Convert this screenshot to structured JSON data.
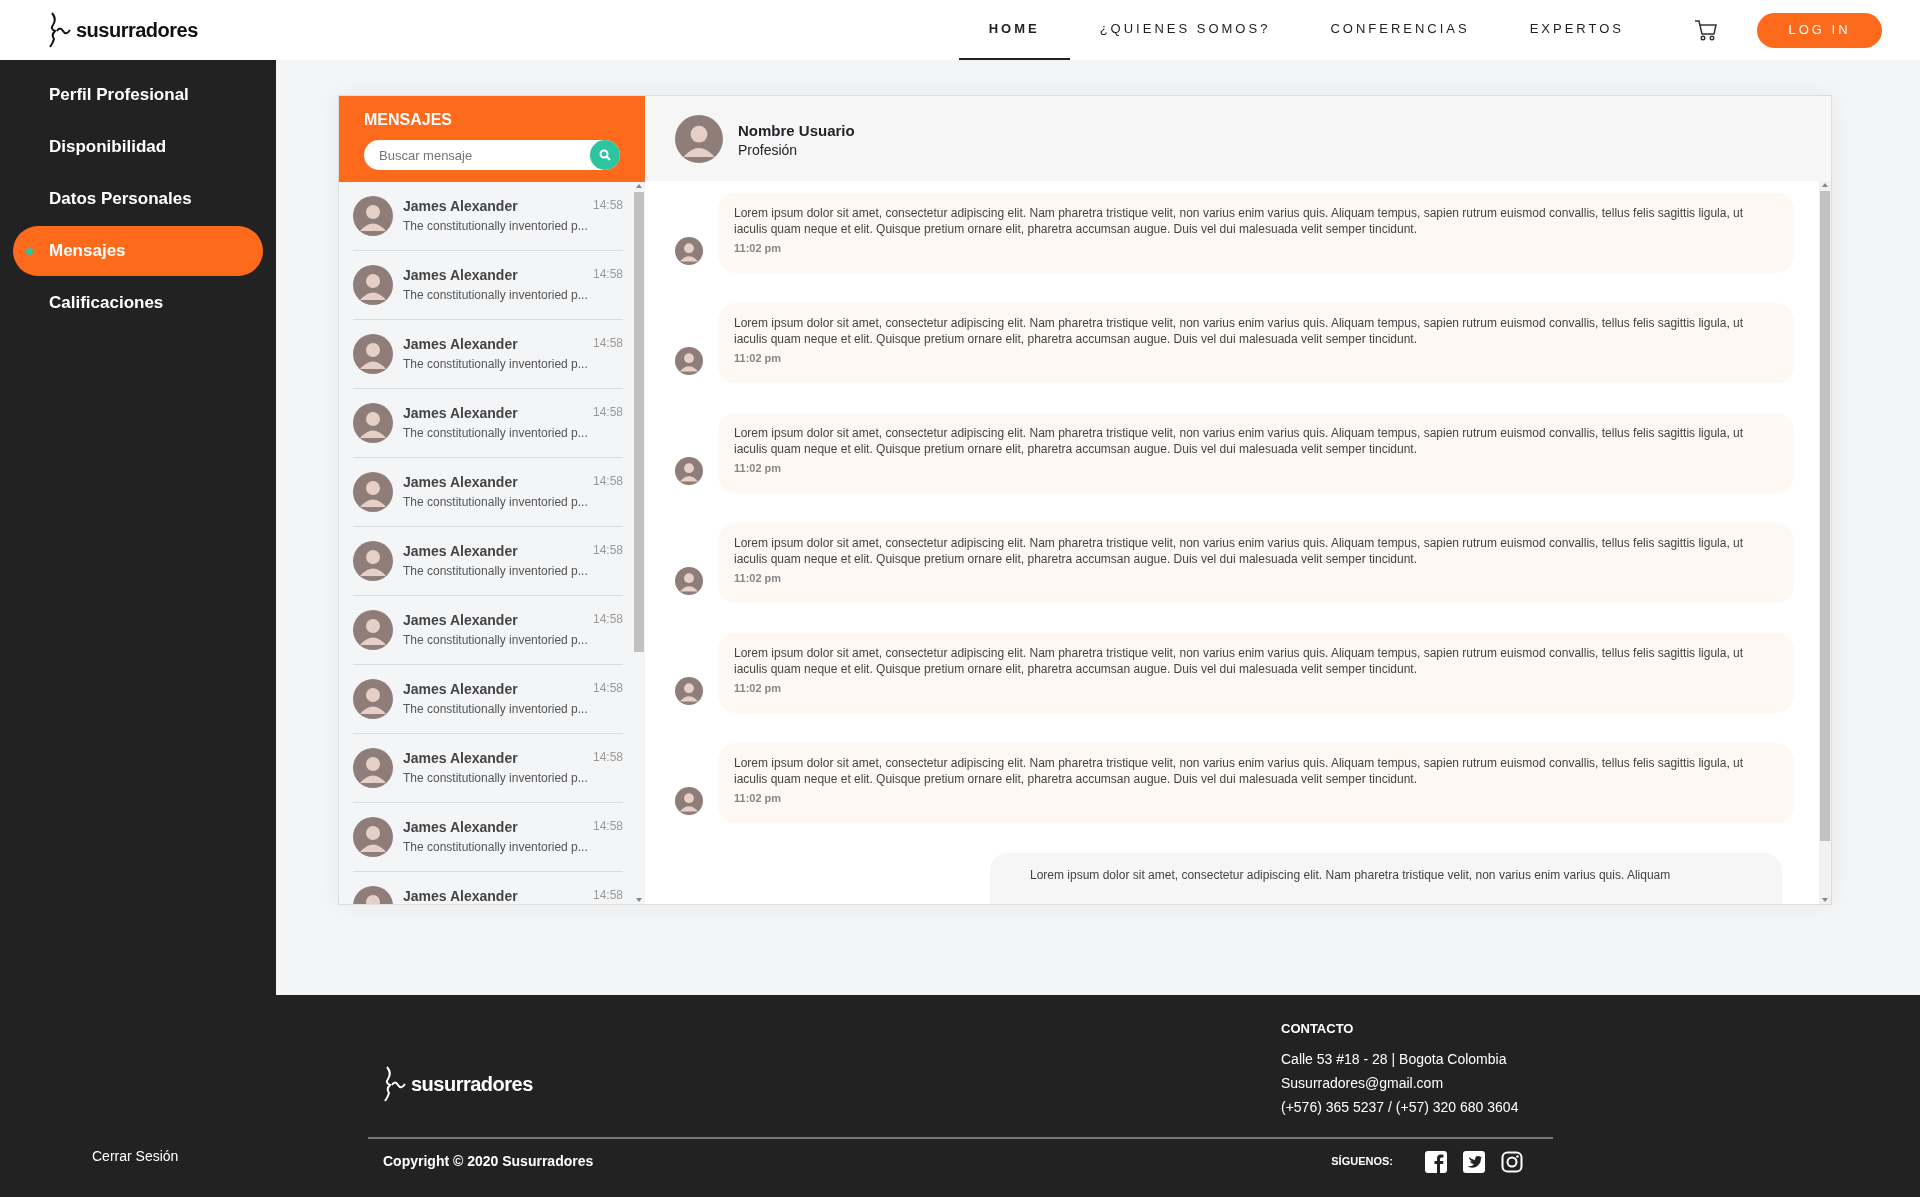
{
  "header": {
    "logo": "susurradores",
    "nav": [
      {
        "label": "HOME",
        "selected": true
      },
      {
        "label": "¿QUIENES SOMOS?",
        "selected": false
      },
      {
        "label": "CONFERENCIAS",
        "selected": false
      },
      {
        "label": "EXPERTOS",
        "selected": false
      }
    ],
    "login": "LOG IN"
  },
  "sidebar": {
    "items": [
      {
        "label": "Perfil Profesional",
        "selected": false
      },
      {
        "label": "Disponibilidad",
        "selected": false
      },
      {
        "label": "Datos Personales",
        "selected": false
      },
      {
        "label": "Mensajes",
        "selected": true
      },
      {
        "label": "Calificaciones",
        "selected": false
      }
    ],
    "logout": "Cerrar Sesión"
  },
  "messages": {
    "title": "MENSAJES",
    "search": {
      "placeholder": "Buscar mensaje"
    },
    "conversations": [
      {
        "name": "James Alexander",
        "time": "14:58",
        "preview": "The constitutionally inventoried p..."
      },
      {
        "name": "James Alexander",
        "time": "14:58",
        "preview": "The constitutionally inventoried p..."
      },
      {
        "name": "James Alexander",
        "time": "14:58",
        "preview": "The constitutionally inventoried p..."
      },
      {
        "name": "James Alexander",
        "time": "14:58",
        "preview": "The constitutionally inventoried p..."
      },
      {
        "name": "James Alexander",
        "time": "14:58",
        "preview": "The constitutionally inventoried p..."
      },
      {
        "name": "James Alexander",
        "time": "14:58",
        "preview": "The constitutionally inventoried p..."
      },
      {
        "name": "James Alexander",
        "time": "14:58",
        "preview": "The constitutionally inventoried p..."
      },
      {
        "name": "James Alexander",
        "time": "14:58",
        "preview": "The constitutionally inventoried p..."
      },
      {
        "name": "James Alexander",
        "time": "14:58",
        "preview": "The constitutionally inventoried p..."
      },
      {
        "name": "James Alexander",
        "time": "14:58",
        "preview": "The constitutionally inventoried p..."
      },
      {
        "name": "James Alexander",
        "time": "14:58"
      }
    ]
  },
  "chat": {
    "user": {
      "name": "Nombre Usuario",
      "subtitle": "Profesión"
    },
    "messages": [
      {
        "kind": "incoming",
        "text": "Lorem ipsum dolor sit amet, consectetur adipiscing elit. Nam pharetra tristique velit, non varius enim varius quis. Aliquam tempus, sapien rutrum euismod convallis, tellus felis sagittis ligula, ut iaculis quam neque et elit. Quisque pretium ornare elit, pharetra accumsan augue. Duis vel dui malesuada velit semper tincidunt.",
        "time": "11:02 pm"
      },
      {
        "kind": "incoming",
        "text": "Lorem ipsum dolor sit amet, consectetur adipiscing elit. Nam pharetra tristique velit, non varius enim varius quis. Aliquam tempus, sapien rutrum euismod convallis, tellus felis sagittis ligula, ut iaculis quam neque et elit. Quisque pretium ornare elit, pharetra accumsan augue. Duis vel dui malesuada velit semper tincidunt.",
        "time": "11:02 pm"
      },
      {
        "kind": "incoming",
        "text": "Lorem ipsum dolor sit amet, consectetur adipiscing elit. Nam pharetra tristique velit, non varius enim varius quis. Aliquam tempus, sapien rutrum euismod convallis, tellus felis sagittis ligula, ut iaculis quam neque et elit. Quisque pretium ornare elit, pharetra accumsan augue. Duis vel dui malesuada velit semper tincidunt.",
        "time": "11:02 pm"
      },
      {
        "kind": "incoming",
        "text": "Lorem ipsum dolor sit amet, consectetur adipiscing elit. Nam pharetra tristique velit, non varius enim varius quis. Aliquam tempus, sapien rutrum euismod convallis, tellus felis sagittis ligula, ut iaculis quam neque et elit. Quisque pretium ornare elit, pharetra accumsan augue. Duis vel dui malesuada velit semper tincidunt.",
        "time": "11:02 pm"
      },
      {
        "kind": "incoming",
        "text": "Lorem ipsum dolor sit amet, consectetur adipiscing elit. Nam pharetra tristique velit, non varius enim varius quis. Aliquam tempus, sapien rutrum euismod convallis, tellus felis sagittis ligula, ut iaculis quam neque et elit. Quisque pretium ornare elit, pharetra accumsan augue. Duis vel dui malesuada velit semper tincidunt.",
        "time": "11:02 pm"
      },
      {
        "kind": "incoming",
        "text": "Lorem ipsum dolor sit amet, consectetur adipiscing elit. Nam pharetra tristique velit, non varius enim varius quis. Aliquam tempus, sapien rutrum euismod convallis, tellus felis sagittis ligula, ut iaculis quam neque et elit. Quisque pretium ornare elit, pharetra accumsan augue. Duis vel dui malesuada velit semper tincidunt.",
        "time": "11:02 pm"
      },
      {
        "kind": "outgoing",
        "text": "Lorem ipsum dolor sit amet, consectetur adipiscing elit. Nam pharetra tristique velit, non varius enim varius quis. Aliquam"
      }
    ]
  },
  "footer": {
    "logo": "susurradores",
    "contact_title": "CONTACTO",
    "contact": [
      "Calle 53 #18 - 28 | Bogota Colombia",
      "Susurradores@gmail.com",
      "(+576) 365 5237 / (+57) 320 680 3604"
    ],
    "copyright": "Copyright © 2020 Susurradores",
    "follow": "SÍGUENOS:"
  }
}
